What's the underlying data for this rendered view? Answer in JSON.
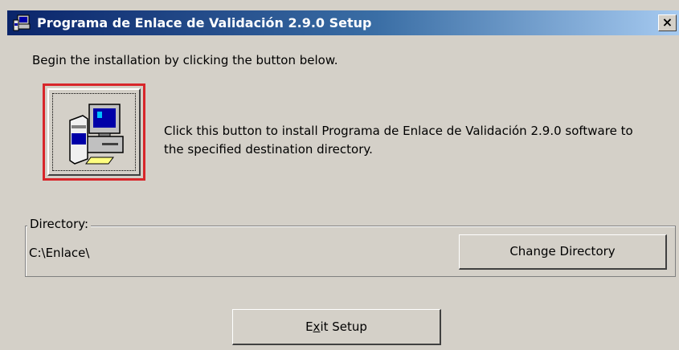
{
  "window": {
    "title": "Programa de Enlace de Validación 2.9.0 Setup",
    "close_glyph": "×",
    "icon": "setup-computer-icon"
  },
  "main": {
    "intro": "Begin the installation by clicking the button below.",
    "install_button_icon": "install-computer-icon",
    "install_text_line1": "Click this button to install Programa de Enlace de Validación 2.9.0 software to",
    "install_text_line2": "the specified destination directory."
  },
  "directory": {
    "legend": "Directory:",
    "path": "C:\\Enlace\\",
    "change_label": "Change Directory"
  },
  "footer": {
    "exit_label_prefix": "E",
    "exit_label_accel": "x",
    "exit_label_suffix": "it Setup"
  },
  "colors": {
    "titlebar_start": "#0a246a",
    "titlebar_end": "#a6caf0",
    "face": "#d4d0c8",
    "highlight_border": "#d8262a"
  }
}
